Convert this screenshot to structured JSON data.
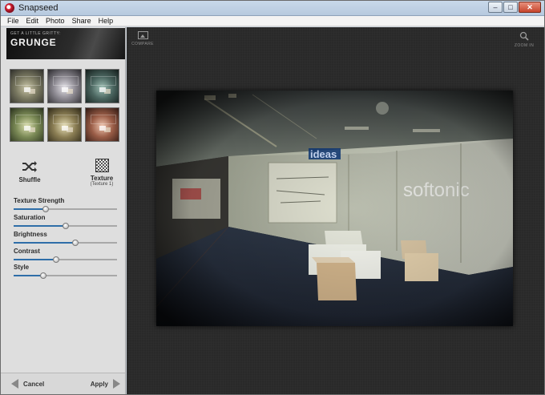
{
  "window": {
    "title": "Snapseed",
    "min_glyph": "–",
    "max_glyph": "□",
    "close_glyph": "✕"
  },
  "menu": [
    "File",
    "Edit",
    "Photo",
    "Share",
    "Help"
  ],
  "filter": {
    "subtitle": "GET A LITTLE GRITTY:",
    "name": "GRUNGE"
  },
  "thumbnails": [
    "style-1",
    "style-2",
    "style-3",
    "style-4",
    "style-5",
    "style-6"
  ],
  "tools": {
    "shuffle": {
      "label": "Shuffle",
      "icon": "shuffle-icon"
    },
    "texture": {
      "label": "Texture",
      "sublabel": "(Texture 1)",
      "icon": "texture-icon"
    }
  },
  "sliders": [
    {
      "id": "texture-strength",
      "label": "Texture Strength",
      "value": 0.31
    },
    {
      "id": "saturation",
      "label": "Saturation",
      "value": 0.5
    },
    {
      "id": "brightness",
      "label": "Brightness",
      "value": 0.6
    },
    {
      "id": "contrast",
      "label": "Contrast",
      "value": 0.41
    },
    {
      "id": "style",
      "label": "Style",
      "value": 0.29
    }
  ],
  "bottom": {
    "cancel_label": "Cancel",
    "apply_label": "Apply"
  },
  "canvas": {
    "compare_label": "COMPARE",
    "zoom_label": "ZOOM IN",
    "photo_signs": {
      "ideas": "ideas",
      "softonic": "softonic"
    }
  },
  "colors": {
    "slider_fill": "#2f6ea8",
    "canvas_bg": "#2b2b2b",
    "title_gradient": "#c9d9ea"
  }
}
